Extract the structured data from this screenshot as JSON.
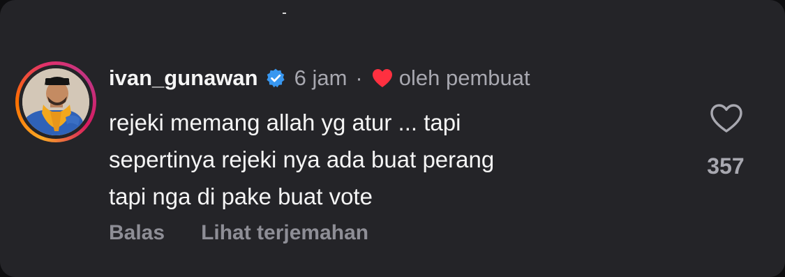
{
  "comment": {
    "username": "ivan_gunawan",
    "time": "6 jam",
    "separator": "·",
    "liked_by_creator": "oleh pembuat",
    "text": "rejeki memang allah  yg atur ... tapi\nsepertinya  rejeki nya  ada  buat  perang\ntapi  nga  di pake  buat vote",
    "like_count": "357",
    "actions": {
      "reply": "Balas",
      "translate": "Lihat terjemahan"
    }
  },
  "icons": {
    "verified": "verified-badge-icon",
    "creator_heart": "heart-filled-icon",
    "like": "heart-outline-icon"
  },
  "colors": {
    "background": "#242428",
    "primary_text": "#f5f5f5",
    "secondary_text": "#a8a8b0",
    "verified_blue": "#3897f0",
    "heart_red": "#ff3040"
  }
}
